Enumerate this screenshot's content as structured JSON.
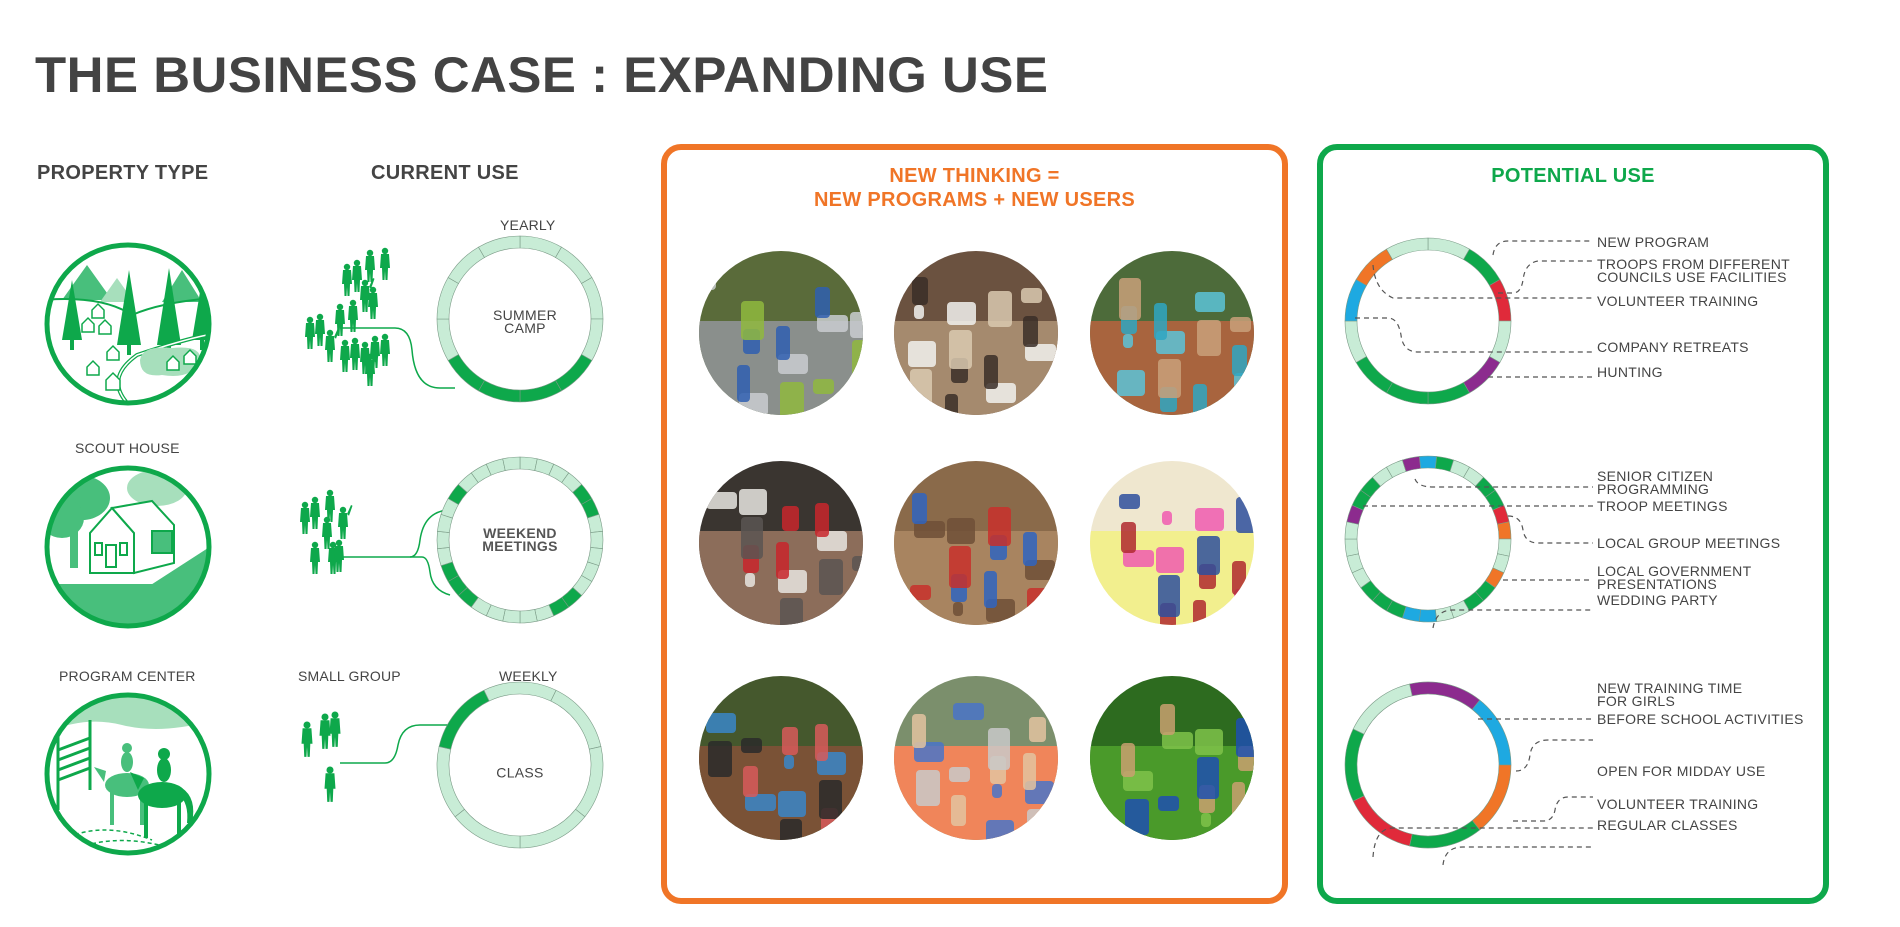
{
  "title": "THE BUSINESS CASE : EXPANDING USE",
  "columns": {
    "property_type": "PROPERTY TYPE",
    "current_use": "CURRENT USE"
  },
  "colors": {
    "dark_green": "#0ea84b",
    "light_green": "#c8ecd6",
    "mid_green": "#48bf7c",
    "orange": "#f07527",
    "red": "#e02a3a",
    "blue": "#1ea9e1",
    "purple": "#8c2b8e",
    "text": "#444444"
  },
  "properties": [
    {
      "name": "Camp",
      "label": "",
      "icon": "camp-landscape-icon",
      "group_label": "",
      "group_icon": "large-group-people-icon",
      "ring": {
        "period": "YEARLY",
        "center_label": [
          "SUMMER",
          "CAMP"
        ],
        "segments": 12,
        "offset_deg": 0,
        "used": [
          4,
          5,
          6,
          7
        ]
      }
    },
    {
      "name": "Scout House",
      "label": "SCOUT HOUSE",
      "icon": "scout-house-icon",
      "group_label": "",
      "group_icon": "medium-group-people-icon",
      "ring": {
        "period": "",
        "center_label": [
          "WEEKEND",
          "MEETINGS"
        ],
        "segments": 30,
        "offset_deg": 0,
        "used": [
          4,
          5,
          11,
          12,
          18,
          19,
          20,
          25
        ]
      }
    },
    {
      "name": "Program Center",
      "label": "PROGRAM CENTER",
      "icon": "horse-riding-icon",
      "group_label": "SMALL GROUP",
      "group_icon": "small-group-people-icon",
      "ring": {
        "period": "WEEKLY",
        "center_label": [
          "CLASS"
        ],
        "segments": 7,
        "offset_deg": 25.71,
        "used": [
          5
        ]
      }
    }
  ],
  "new_thinking": {
    "heading": [
      "NEW THINKING =",
      "NEW PROGRAMS + NEW USERS"
    ],
    "photos": [
      {
        "name": "river-exploration-photo",
        "theme": "river"
      },
      {
        "name": "banquet-hall-photo",
        "theme": "banquet"
      },
      {
        "name": "swimming-pool-photo",
        "theme": "pool"
      },
      {
        "name": "conference-presentation-photo",
        "theme": "conference"
      },
      {
        "name": "archaeology-dig-photo",
        "theme": "dig"
      },
      {
        "name": "sticky-note-workshop-photo",
        "theme": "workshop"
      },
      {
        "name": "horseback-riding-photo",
        "theme": "horses"
      },
      {
        "name": "canoeing-photo",
        "theme": "canoe"
      },
      {
        "name": "ropes-course-photo",
        "theme": "ropes"
      }
    ]
  },
  "potential_use": {
    "heading": "POTENTIAL USE",
    "rings": [
      {
        "segments": 12,
        "offset_deg": 0,
        "colors": [
          "light",
          "dark_green",
          "red",
          "light",
          "purple",
          "dark_green",
          "dark_green",
          "dark_green",
          "light",
          "blue",
          "orange",
          "light"
        ],
        "labels": [
          {
            "lines": [
              "NEW PROGRAM"
            ]
          },
          {
            "lines": [
              "TROOPS FROM DIFFERENT",
              "COUNCILS USE FACILITIES"
            ]
          },
          {
            "lines": [
              "VOLUNTEER TRAINING"
            ]
          },
          {
            "lines": [
              "COMPANY RETREATS"
            ]
          },
          {
            "lines": [
              "HUNTING"
            ]
          }
        ]
      },
      {
        "segments": 30,
        "offset_deg": -6,
        "colors": [
          "blue",
          "dark_green",
          "light",
          "light",
          "dark_green",
          "dark_green",
          "red",
          "orange",
          "light",
          "light",
          "orange",
          "dark_green",
          "dark_green",
          "light",
          "light",
          "blue",
          "blue",
          "dark_green",
          "dark_green",
          "dark_green",
          "light",
          "light",
          "light",
          "light",
          "purple",
          "dark_green",
          "dark_green",
          "light",
          "light",
          "purple"
        ],
        "labels": [
          {
            "lines": [
              "SENIOR CITIZEN",
              "PROGRAMMING"
            ]
          },
          {
            "lines": [
              "TROOP MEETINGS"
            ]
          },
          {
            "lines": [
              "LOCAL GROUP MEETINGS"
            ]
          },
          {
            "lines": [
              "LOCAL GOVERNMENT",
              "PRESENTATIONS"
            ]
          },
          {
            "lines": [
              "WEDDING PARTY"
            ]
          }
        ]
      },
      {
        "segments": 7,
        "offset_deg": -12.86,
        "colors": [
          "purple",
          "blue",
          "orange",
          "dark_green",
          "red",
          "dark_green",
          "light"
        ],
        "labels": [
          {
            "lines": [
              "NEW TRAINING TIME",
              "FOR GIRLS"
            ]
          },
          {
            "lines": [
              "BEFORE SCHOOL ACTIVITIES"
            ]
          },
          {
            "lines": [
              "OPEN FOR MIDDAY USE"
            ]
          },
          {
            "lines": [
              "VOLUNTEER TRAINING"
            ]
          },
          {
            "lines": [
              "REGULAR CLASSES"
            ]
          }
        ]
      }
    ]
  }
}
